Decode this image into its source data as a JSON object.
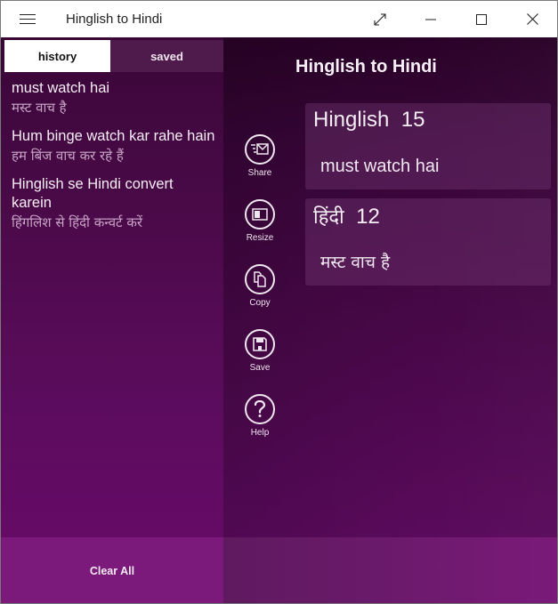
{
  "window": {
    "title": "Hinglish to Hindi",
    "controls": [
      "expand-icon",
      "minimize-icon",
      "maximize-icon",
      "close-icon"
    ]
  },
  "left_panel": {
    "tabs": [
      {
        "label": "history",
        "active": true
      },
      {
        "label": "saved",
        "active": false
      }
    ],
    "history": [
      {
        "hinglish": "must watch hai",
        "hindi": "मस्ट वाच है"
      },
      {
        "hinglish": "Hum binge watch kar rahe hain",
        "hindi": "हम बिंज वाच कर रहे हैं"
      },
      {
        "hinglish": "Hinglish se Hindi convert karein",
        "hindi": "हिंगलिश से हिंदी कन्वर्ट करें"
      }
    ],
    "clear_all_label": "Clear All"
  },
  "main": {
    "heading": "Hinglish to Hindi",
    "actions": [
      {
        "label": "Share",
        "icon": "share-mail-icon"
      },
      {
        "label": "Resize",
        "icon": "resize-icon"
      },
      {
        "label": "Copy",
        "icon": "copy-icon"
      },
      {
        "label": "Save",
        "icon": "save-icon"
      },
      {
        "label": "Help",
        "icon": "help-icon"
      }
    ],
    "input_card": {
      "language": "Hinglish",
      "count": "15",
      "text": "must watch hai"
    },
    "output_card": {
      "language": "हिंदी",
      "count": "12",
      "text": "मस्ट वाच है"
    }
  },
  "colors": {
    "accent": "#7b1a7a",
    "panel_dark": "#3a0638",
    "text_light": "#f4eef4",
    "hindi_muted": "#c7a3c4"
  }
}
